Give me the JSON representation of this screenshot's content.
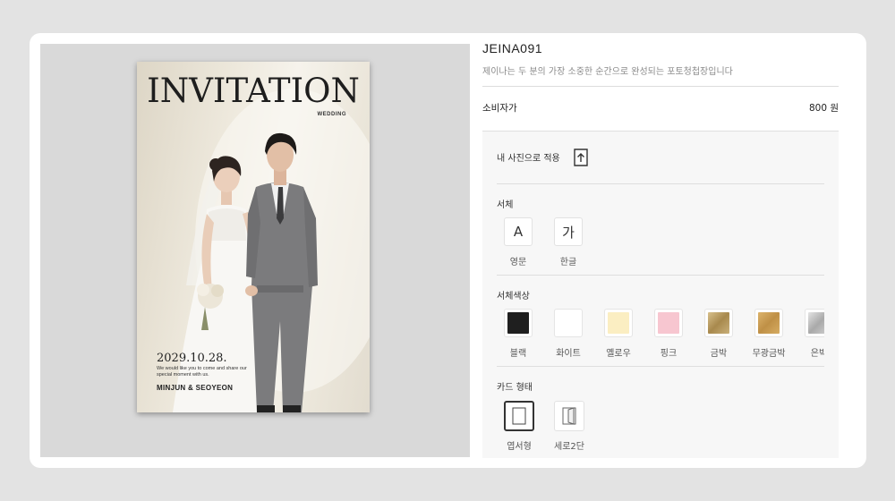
{
  "poster": {
    "title": "INVITATION",
    "subtitle": "WEDDING",
    "date": "2029.10.28.",
    "message": "We would like you to come and share our special moment with us.",
    "names": "MINJUN & SEOYEON"
  },
  "product": {
    "code": "JEINA091",
    "description": "제이나는 두 분의 가장 소중한 순간으로 완성되는 포토청첩장입니다",
    "price_label": "소비자가",
    "price_value": "800 원"
  },
  "options": {
    "apply_photo_label": "내 사진으로 적용",
    "font": {
      "label": "서체",
      "items": [
        {
          "glyph": "A",
          "caption": "영문"
        },
        {
          "glyph": "가",
          "caption": "한글"
        }
      ]
    },
    "font_color": {
      "label": "서체색상",
      "items": [
        {
          "caption": "블랙",
          "color": "#1f1f1f"
        },
        {
          "caption": "화이트",
          "color": "#ffffff"
        },
        {
          "caption": "옐로우",
          "color": "#fbeec2"
        },
        {
          "caption": "핑크",
          "color": "#f7c6d0"
        },
        {
          "caption": "금박",
          "color": "#b69a5f"
        },
        {
          "caption": "무광금박",
          "color": "#c9a05a"
        },
        {
          "caption": "은박",
          "color": "#c4c4c4"
        }
      ]
    },
    "card_shape": {
      "label": "카드 형태",
      "items": [
        {
          "caption": "엽서형",
          "selected": true
        },
        {
          "caption": "세로2단",
          "selected": false
        }
      ]
    }
  }
}
